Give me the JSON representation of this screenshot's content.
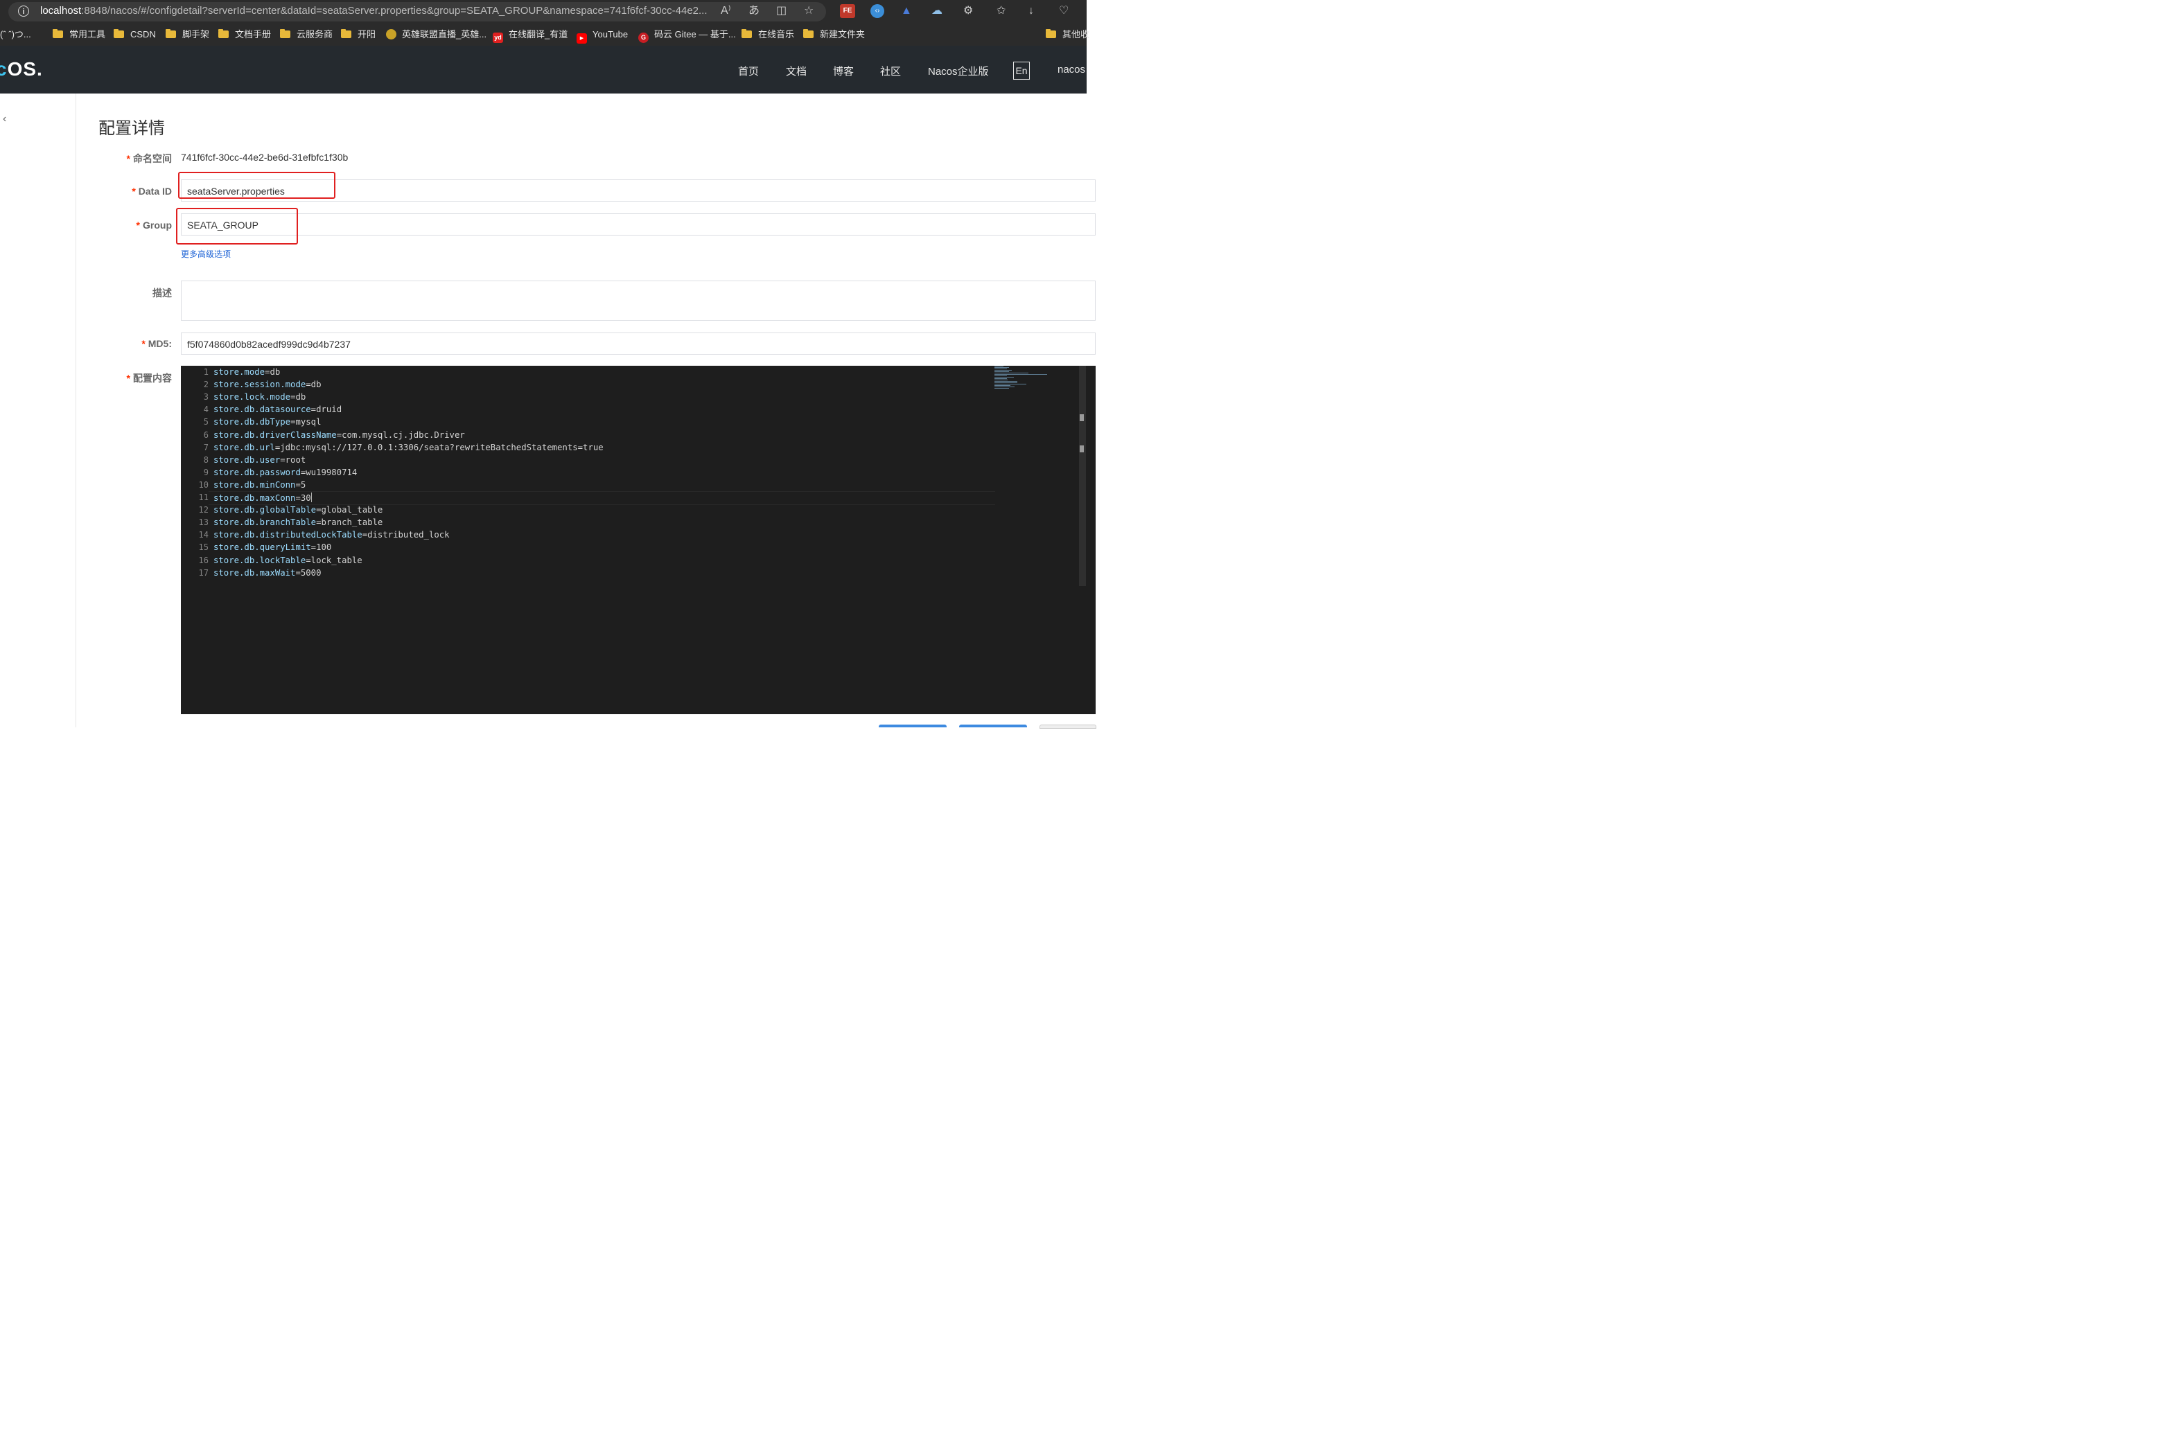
{
  "browser": {
    "url_host": "localhost",
    "url_rest": ":8848/nacos/#/configdetail?serverId=center&dataId=seataServer.properties&group=SEATA_GROUP&namespace=741f6fcf-30cc-44e2...",
    "bookmarks": [
      {
        "label": "(ˆ ˆ)つ...",
        "icon": "face"
      },
      {
        "label": "常用工具",
        "icon": "folder"
      },
      {
        "label": "CSDN",
        "icon": "folder"
      },
      {
        "label": "脚手架",
        "icon": "folder"
      },
      {
        "label": "文档手册",
        "icon": "folder"
      },
      {
        "label": "云服务商",
        "icon": "folder"
      },
      {
        "label": "开阳",
        "icon": "folder"
      },
      {
        "label": "英雄联盟直播_英雄...",
        "icon": "lol"
      },
      {
        "label": "在线翻译_有道",
        "icon": "youdao"
      },
      {
        "label": "YouTube",
        "icon": "youtube"
      },
      {
        "label": "码云 Gitee — 基于...",
        "icon": "gitee"
      },
      {
        "label": "在线音乐",
        "icon": "folder"
      },
      {
        "label": "新建文件夹",
        "icon": "folder"
      },
      {
        "label": "其他收",
        "icon": "folder"
      }
    ],
    "ext_labels": {
      "fe": "FE",
      "yd": "yd",
      "g": "G"
    }
  },
  "header": {
    "logo_a": "c",
    "logo_b": "OS.",
    "nav": [
      "首页",
      "文档",
      "博客",
      "社区",
      "Nacos企业版"
    ],
    "lang": "En",
    "user": "nacos"
  },
  "page": {
    "title": "配置详情",
    "namespace_label": "命名空间",
    "namespace_value": "741f6fcf-30cc-44e2-be6d-31efbfc1f30b",
    "dataid_label": "Data ID",
    "dataid_value": "seataServer.properties",
    "group_label": "Group",
    "group_value": "SEATA_GROUP",
    "advanced_link": "更多高级选项",
    "desc_label": "描述",
    "desc_value": "",
    "md5_label": "MD5:",
    "md5_value": "f5f074860d0b82acedf999dc9d4b7237",
    "content_label": "配置内容",
    "required_mark": "*"
  },
  "editor": {
    "lines": [
      {
        "n": "1",
        "key": "store.mode",
        "val": "db"
      },
      {
        "n": "2",
        "key": "store.session.mode",
        "val": "db"
      },
      {
        "n": "3",
        "key": "store.lock.mode",
        "val": "db"
      },
      {
        "n": "4",
        "key": "store.db.datasource",
        "val": "druid"
      },
      {
        "n": "5",
        "key": "store.db.dbType",
        "val": "mysql"
      },
      {
        "n": "6",
        "key": "store.db.driverClassName",
        "val": "com.mysql.cj.jdbc.Driver"
      },
      {
        "n": "7",
        "key": "store.db.url",
        "val": "jdbc:mysql://127.0.0.1:3306/seata?rewriteBatchedStatements=true"
      },
      {
        "n": "8",
        "key": "store.db.user",
        "val": "root"
      },
      {
        "n": "9",
        "key": "store.db.password",
        "val": "wu19980714"
      },
      {
        "n": "10",
        "key": "store.db.minConn",
        "val": "5"
      },
      {
        "n": "11",
        "key": "store.db.maxConn",
        "val": "30"
      },
      {
        "n": "12",
        "key": "store.db.globalTable",
        "val": "global_table"
      },
      {
        "n": "13",
        "key": "store.db.branchTable",
        "val": "branch_table"
      },
      {
        "n": "14",
        "key": "store.db.distributedLockTable",
        "val": "distributed_lock"
      },
      {
        "n": "15",
        "key": "store.db.queryLimit",
        "val": "100"
      },
      {
        "n": "16",
        "key": "store.db.lockTable",
        "val": "lock_table"
      },
      {
        "n": "17",
        "key": "store.db.maxWait",
        "val": "5000"
      }
    ]
  },
  "colors": {
    "accent": "#1f64d6",
    "highlight": "#e02020",
    "header_bg": "#252a2f",
    "editor_bg": "#1e1e1e"
  }
}
